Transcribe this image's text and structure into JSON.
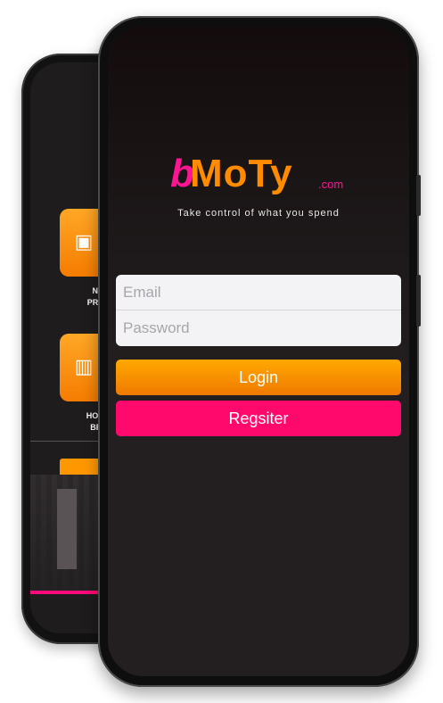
{
  "colors": {
    "brand_pink": "#ff1493",
    "brand_orange": "#ff8c00",
    "login_button": "#ff9800",
    "register_button": "#ff0a6c",
    "screen_background": "#231f20"
  },
  "back_screen": {
    "tiles": [
      {
        "icon": "gift-box-icon",
        "label_line1": "NEW",
        "label_line2": "PRODU"
      },
      {
        "icon": "suitcase-icon",
        "label_line1": "HOLIDA",
        "label_line2": "BREA"
      }
    ]
  },
  "logo": {
    "letter_b": "b",
    "letters_moty": "MoTy",
    "suffix": ".com"
  },
  "tagline": "Take control of what you spend",
  "login_form": {
    "email_placeholder": "Email",
    "password_placeholder": "Password",
    "login_label": "Login",
    "register_label": "Regsiter"
  }
}
